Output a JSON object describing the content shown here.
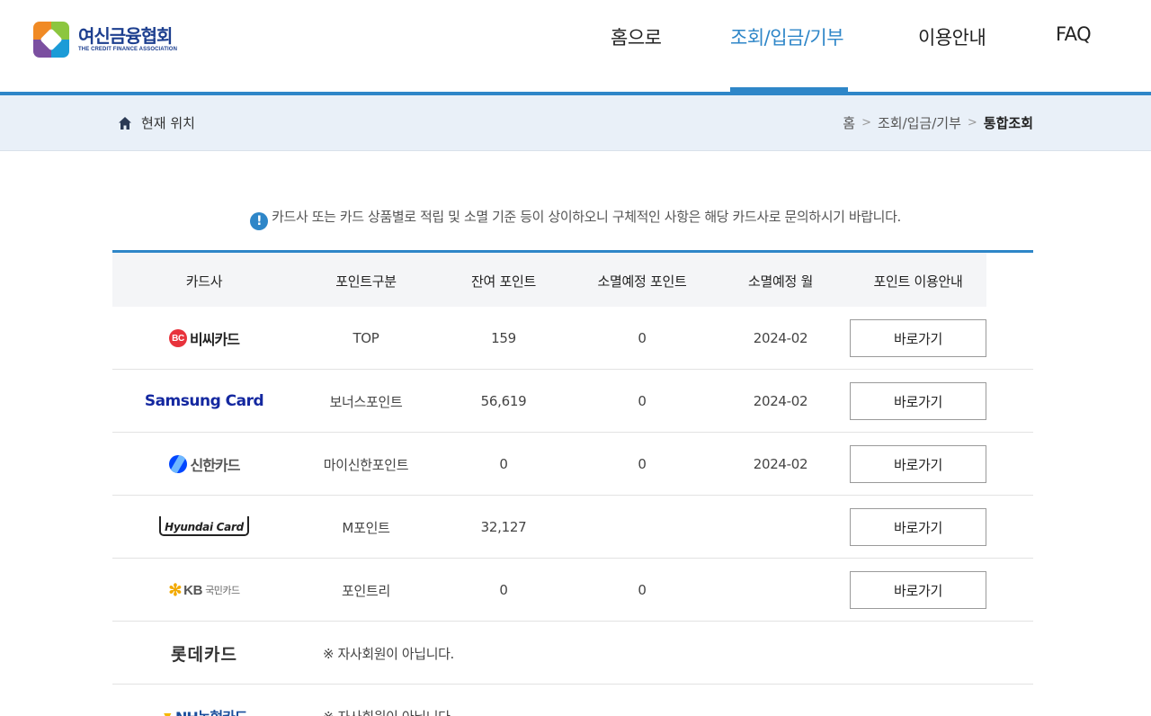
{
  "header": {
    "logo": {
      "name_ko": "여신금융협회",
      "name_en": "THE CREDIT FINANCE ASSOCIATION"
    },
    "nav": [
      {
        "label": "홈으로",
        "active": false
      },
      {
        "label": "조회/입금/기부",
        "active": true
      },
      {
        "label": "이용안내",
        "active": false
      },
      {
        "label": "FAQ",
        "active": false
      }
    ],
    "accent_color": "#2e86c8"
  },
  "breadcrumb": {
    "location_label": "현재 위치",
    "path": [
      "홈",
      "조회/입금/기부",
      "통합조회"
    ],
    "separator": ">"
  },
  "notice": {
    "icon": "exclamation-icon",
    "text": "카드사 또는 카드 상품별로 적립 및 소멸 기준 등이 상이하오니 구체적인 사항은 해당 카드사로 문의하시기 바랍니다."
  },
  "table": {
    "headers": [
      "카드사",
      "포인트구분",
      "잔여 포인트",
      "소멸예정 포인트",
      "소멸예정 월",
      "포인트 이용안내"
    ],
    "rows": [
      {
        "logo_text": "비씨카드",
        "logo_mark": "BC",
        "point_type": "TOP",
        "remaining": "159",
        "expiring": "0",
        "expiry_month": "2024-02",
        "button": "바로가기"
      },
      {
        "logo_text": "Samsung Card",
        "point_type": "보너스포인트",
        "remaining": "56,619",
        "expiring": "0",
        "expiry_month": "2024-02",
        "button": "바로가기"
      },
      {
        "logo_text": "신한카드",
        "point_type": "마이신한포인트",
        "remaining": "0",
        "expiring": "0",
        "expiry_month": "2024-02",
        "button": "바로가기"
      },
      {
        "logo_text": "Hyundai Card",
        "point_type": "M포인트",
        "remaining": "32,127",
        "expiring": "",
        "expiry_month": "",
        "button": "바로가기"
      },
      {
        "logo_text": "KB",
        "logo_sub": "국민카드",
        "point_type": "포인트리",
        "remaining": "0",
        "expiring": "0",
        "expiry_month": "",
        "button": "바로가기"
      },
      {
        "logo_text": "롯데카드",
        "note": "※ 자사회원이 아닙니다."
      },
      {
        "logo_text": "NH농협카드",
        "note": "※ 자사회원이 아닙니다."
      }
    ]
  }
}
